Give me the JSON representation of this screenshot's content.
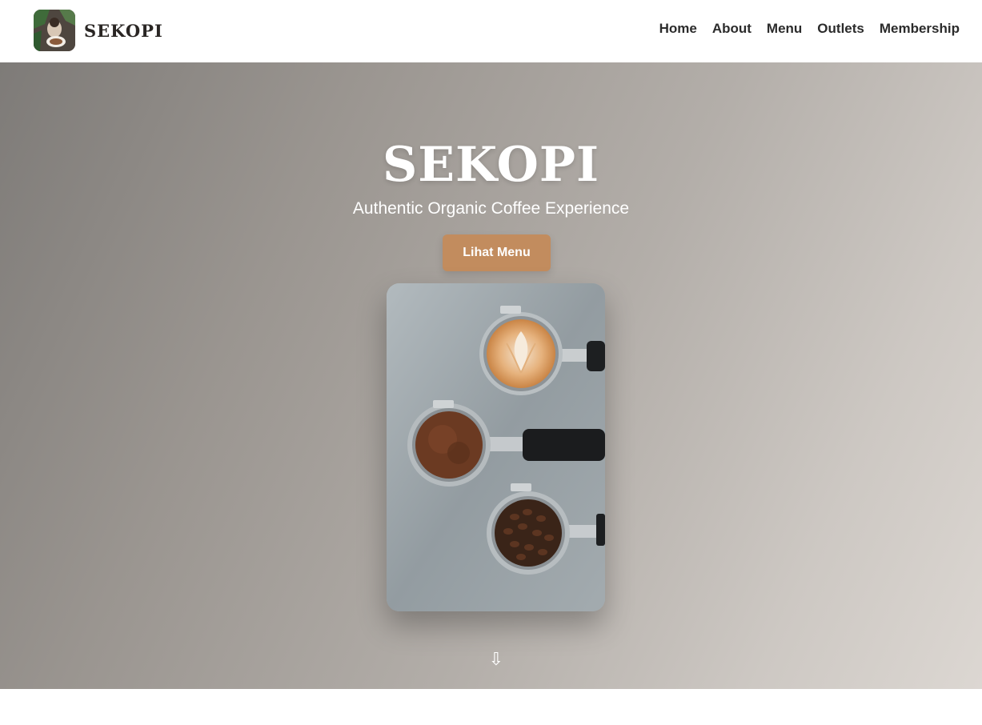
{
  "navbar": {
    "brand_name": "SEKOPI",
    "links": [
      "Home",
      "About",
      "Menu",
      "Outlets",
      "Membership"
    ]
  },
  "hero": {
    "title": "SEKOPI",
    "subtitle": "Authentic Organic Coffee Experience",
    "cta_label": "Lihat Menu",
    "scroll_icon": "⇩"
  },
  "colors": {
    "accent": "#c28c5e",
    "text_dark": "#2b2b2b",
    "hero_gradient_start": "#7e7b78",
    "hero_gradient_end": "#dcd7d2"
  },
  "icons": {
    "scroll": "arrow-down-icon"
  }
}
